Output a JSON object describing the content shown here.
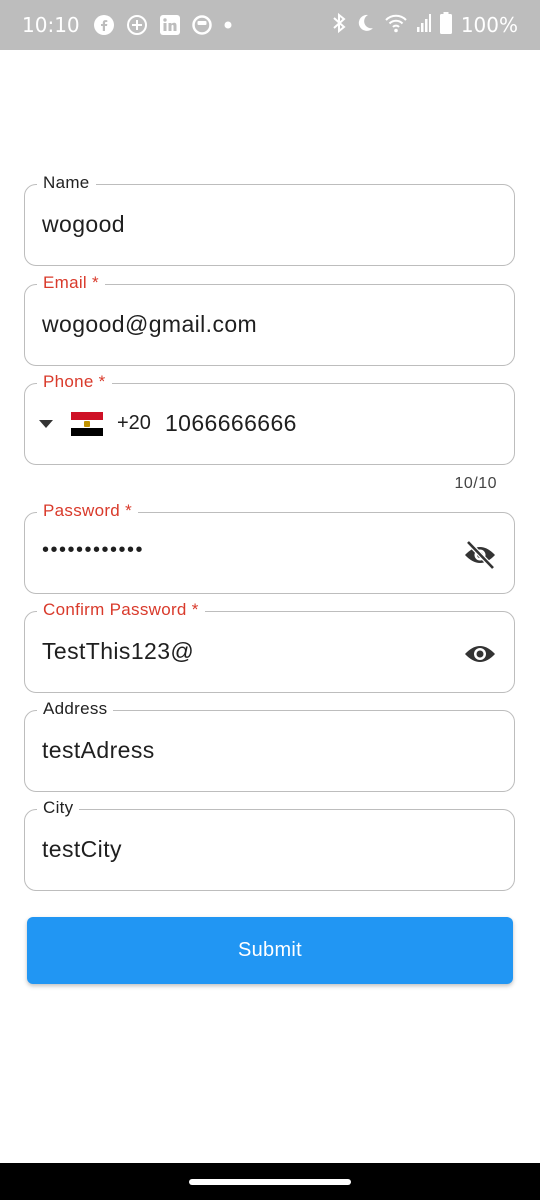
{
  "status_bar": {
    "time": "10:10",
    "battery": "100%",
    "left_icons": [
      "facebook-icon",
      "messenger-icon",
      "linkedin-icon",
      "app-icon",
      "dot-icon"
    ],
    "right_icons": [
      "bluetooth-icon",
      "moon-icon",
      "wifi-icon",
      "signal-icon",
      "battery-icon"
    ]
  },
  "form": {
    "name": {
      "label": "Name",
      "value": "wogood"
    },
    "email": {
      "label": "Email *",
      "value": "wogood@gmail.com"
    },
    "phone": {
      "label": "Phone *",
      "country": "Egypt",
      "dial_code": "+20",
      "number": "1066666666",
      "counter": "10/10"
    },
    "password": {
      "label": "Password *",
      "value": "••••••••••••",
      "icon": "eye-off-icon"
    },
    "confirm_password": {
      "label": "Confirm Password *",
      "value": "TestThis123@",
      "icon": "eye-icon"
    },
    "address": {
      "label": "Address",
      "value": "testAdress"
    },
    "city": {
      "label": "City",
      "value": "testCity"
    },
    "submit_label": "Submit"
  },
  "colors": {
    "required_label": "#d93a2b",
    "submit_button": "#2196f3",
    "status_bar": "#bdbdbd",
    "field_border": "#bdbdbd"
  }
}
